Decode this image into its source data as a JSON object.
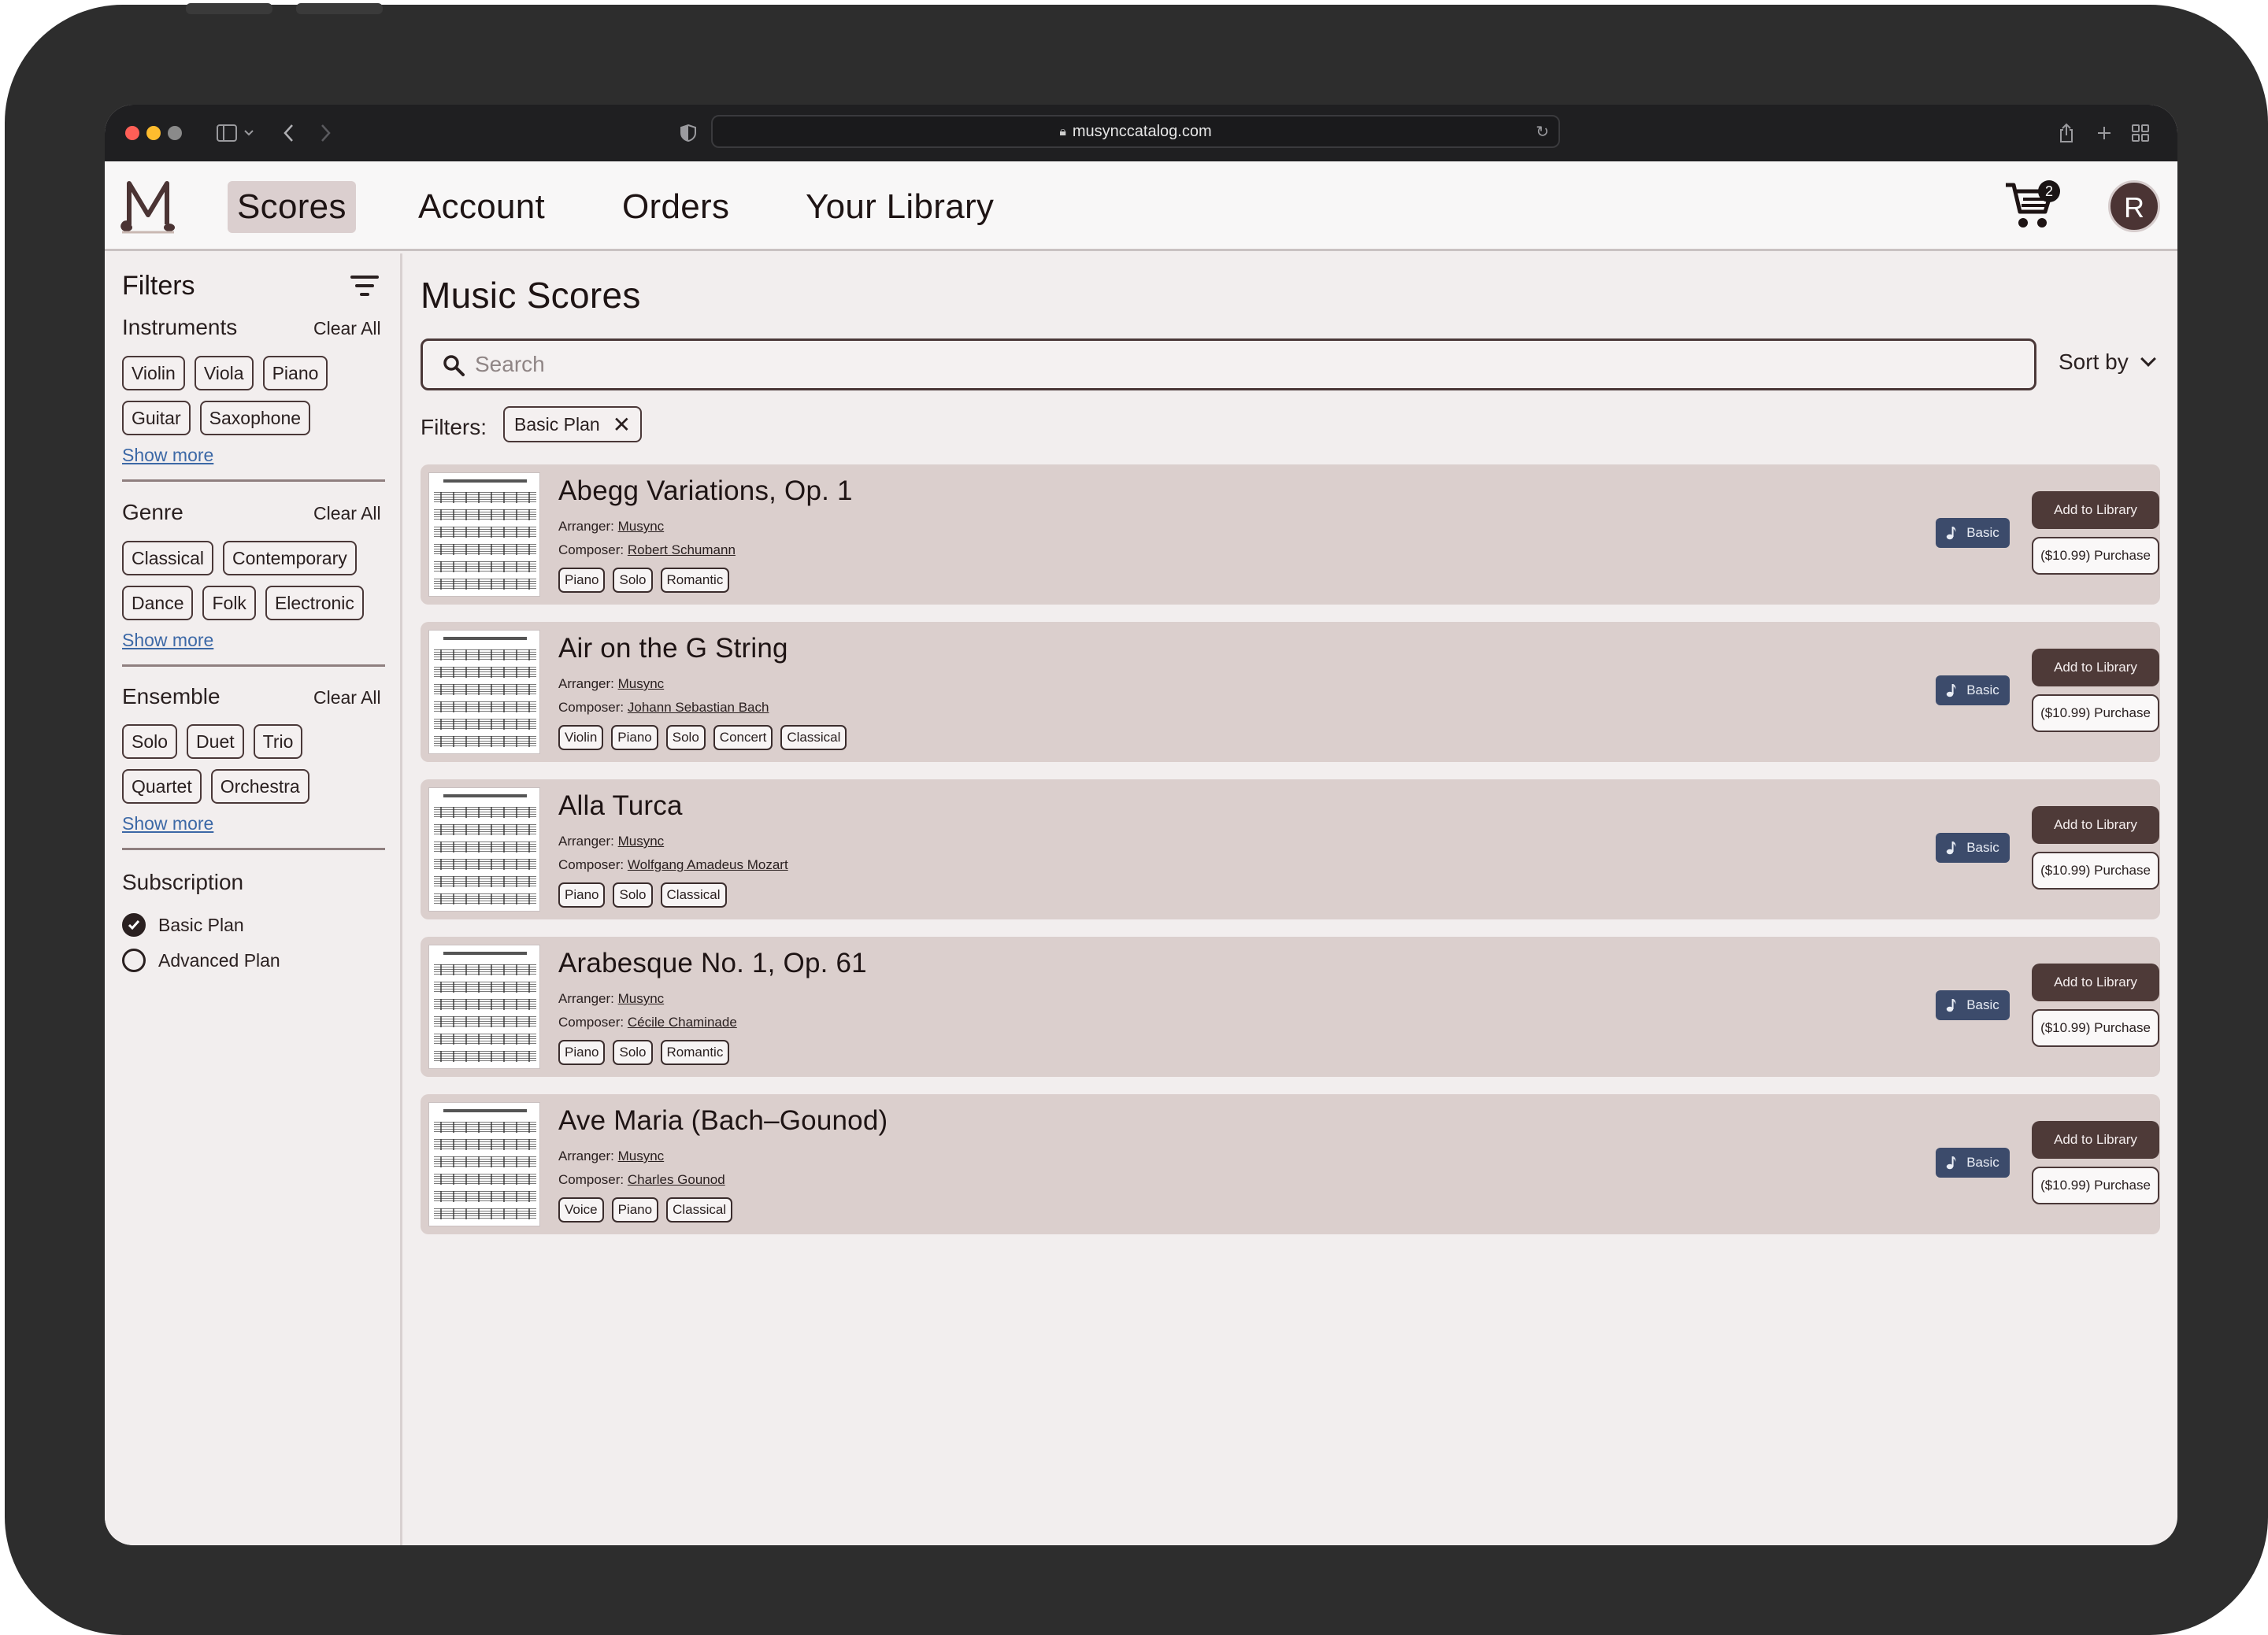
{
  "browser": {
    "url": "musynccatalog.com"
  },
  "header": {
    "logo_letter": "M",
    "nav": [
      {
        "label": "Scores",
        "active": true
      },
      {
        "label": "Account",
        "active": false
      },
      {
        "label": "Orders",
        "active": false
      },
      {
        "label": "Your Library",
        "active": false
      }
    ],
    "cart_count": "2",
    "avatar_initial": "R"
  },
  "sidebar": {
    "title": "Filters",
    "clear_all": "Clear All",
    "show_more": "Show more",
    "instruments": {
      "title": "Instruments",
      "row1": [
        "Violin",
        "Viola",
        "Piano"
      ],
      "row2": [
        "Guitar",
        "Saxophone"
      ]
    },
    "genre": {
      "title": "Genre",
      "row1": [
        "Classical",
        "Contemporary"
      ],
      "row2": [
        "Dance",
        "Folk",
        "Electronic"
      ]
    },
    "ensemble": {
      "title": "Ensemble",
      "row1": [
        "Solo",
        "Duet",
        "Trio"
      ],
      "row2": [
        "Quartet",
        "Orchestra"
      ]
    },
    "subscription": {
      "title": "Subscription",
      "options": [
        {
          "label": "Basic Plan",
          "checked": true
        },
        {
          "label": "Advanced Plan",
          "checked": false
        }
      ]
    }
  },
  "main": {
    "title": "Music Scores",
    "search_placeholder": "Search",
    "sort_label": "Sort by",
    "filters_label": "Filters:",
    "active_filter": "Basic Plan",
    "arranger_label": "Arranger:",
    "composer_label": "Composer:",
    "add_label": "Add to Library",
    "purchase_label": "($10.99) Purchase",
    "plan_badge": "Basic",
    "scores": [
      {
        "title": "Abegg Variations, Op. 1",
        "arranger": "Musync",
        "composer": "Robert Schumann",
        "tags": [
          "Piano",
          "Solo",
          "Romantic"
        ]
      },
      {
        "title": "Air on the G String",
        "arranger": "Musync",
        "composer": "Johann Sebastian Bach",
        "tags": [
          "Violin",
          "Piano",
          "Solo",
          "Concert",
          "Classical"
        ]
      },
      {
        "title": "Alla Turca",
        "arranger": "Musync",
        "composer": "Wolfgang Amadeus Mozart",
        "tags": [
          "Piano",
          "Solo",
          "Classical"
        ]
      },
      {
        "title": "Arabesque No. 1, Op. 61",
        "arranger": "Musync",
        "composer": "Cécile Chaminade",
        "tags": [
          "Piano",
          "Solo",
          "Romantic"
        ]
      },
      {
        "title": "Ave Maria (Bach–Gounod)",
        "arranger": "Musync",
        "composer": "Charles Gounod",
        "tags": [
          "Voice",
          "Piano",
          "Classical"
        ]
      }
    ]
  }
}
